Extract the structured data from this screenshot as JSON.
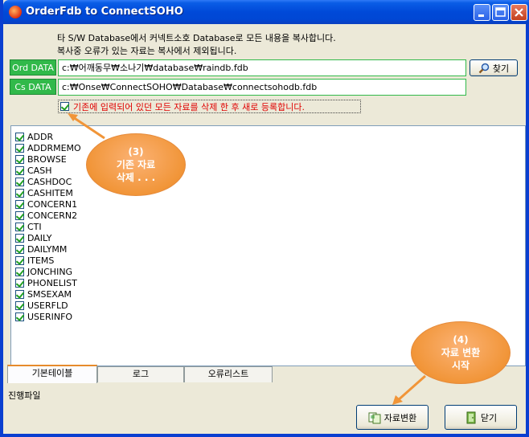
{
  "window": {
    "title": "OrderFdb to ConnectSOHO"
  },
  "description": {
    "line1": "타 S/W Database에서 커넥트소호 Database로 모든 내용을 복사합니다.",
    "line2": "복사중 오류가 있는 자료는 복사에서 제외됩니다."
  },
  "ord": {
    "label": "Ord DATA",
    "path": "c:₩어깨동무₩소나기₩database₩raindb.fdb",
    "find_button": "찾기"
  },
  "cs": {
    "label": "Cs DATA",
    "path": "c:₩Onse₩ConnectSOHO₩Database₩connectsohodb.fdb"
  },
  "delete_option": {
    "checked": true,
    "label": "기존에 입력되어 있던 모든 자료를 삭제 한 후 새로 등록합니다."
  },
  "tables": [
    "ADDR",
    "ADDRMEMO",
    "BROWSE",
    "CASH",
    "CASHDOC",
    "CASHITEM",
    "CONCERN1",
    "CONCERN2",
    "CTI",
    "DAILY",
    "DAILYMM",
    "ITEMS",
    "JONCHING",
    "PHONELIST",
    "SMSEXAM",
    "USERFLD",
    "USERINFO"
  ],
  "callouts": {
    "c3": {
      "num": "(3)",
      "line1": "기존 자료",
      "line2": "삭제 . . ."
    },
    "c4": {
      "num": "(4)",
      "line1": "자료 변환",
      "line2": "시작"
    }
  },
  "tabs": [
    "기본테이블",
    "로그",
    "오류리스트"
  ],
  "status_label": "진행파일",
  "buttons": {
    "convert": "자료변환",
    "close": "닫기"
  },
  "colors": {
    "label_green": "#31b94a",
    "warning_red": "#e00000",
    "callout_orange": "#f19538",
    "title_blue": "#0049d8"
  }
}
